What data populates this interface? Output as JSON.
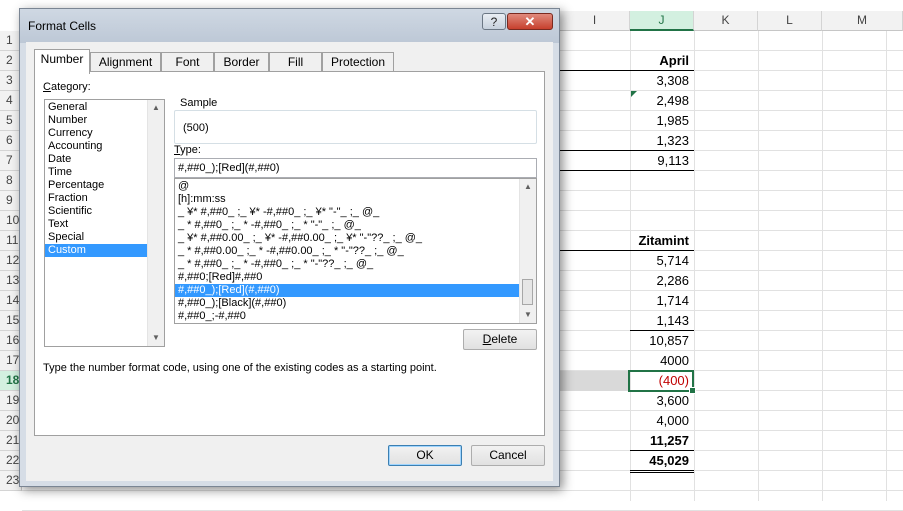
{
  "sheet": {
    "columns": [
      "I",
      "J",
      "K",
      "L",
      "M"
    ],
    "rows": [
      "1",
      "2",
      "3",
      "4",
      "5",
      "6",
      "7",
      "8",
      "9",
      "10",
      "11",
      "12",
      "13",
      "14",
      "15",
      "16",
      "17",
      "18",
      "19",
      "20",
      "21",
      "22",
      "23"
    ],
    "cells": {
      "r2": "April",
      "r3": "3,308",
      "r4": "2,498",
      "r5": "1,985",
      "r6": "1,323",
      "r7": "9,113",
      "r11": "Zitamint",
      "r12": "5,714",
      "r13": "2,286",
      "r14": "1,714",
      "r15": "1,143",
      "r16": "10,857",
      "r17": "4000",
      "r18": "(400)",
      "r19": "3,600",
      "r20": "4,000",
      "r21": "11,257",
      "r22": "45,029"
    },
    "negative_color": "#c00000",
    "accent": "#217346"
  },
  "dialog": {
    "title": "Format Cells",
    "help_glyph": "?",
    "close_glyph": "✕",
    "tabs": [
      "Number",
      "Alignment",
      "Font",
      "Border",
      "Fill",
      "Protection"
    ],
    "active_tab": "Number",
    "category_label_u": "C",
    "category_label_rest": "ategory:",
    "categories": [
      "General",
      "Number",
      "Currency",
      "Accounting",
      "Date",
      "Time",
      "Percentage",
      "Fraction",
      "Scientific",
      "Text",
      "Special",
      "Custom"
    ],
    "selected_category": "Custom",
    "sample_label": "Sample",
    "sample_value": "(500)",
    "type_label_u": "T",
    "type_label_rest": "ype:",
    "type_value": "#,##0_);[Red](#,##0)",
    "formats": [
      "@",
      "[h]:mm:ss",
      "_ ¥* #,##0_ ;_ ¥* -#,##0_ ;_ ¥* \"-\"_ ;_ @_",
      "_ * #,##0_ ;_ * -#,##0_ ;_ * \"-\"_ ;_ @_",
      "_ ¥* #,##0.00_ ;_ ¥* -#,##0.00_ ;_ ¥* \"-\"??_ ;_ @_",
      "_ * #,##0.00_ ;_ * -#,##0.00_ ;_ * \"-\"??_ ;_ @_",
      "_ * #,##0_ ;_ * -#,##0_ ;_ * \"-\"??_ ;_ @_",
      "#,##0;[Red]#,##0",
      "#,##0_);[Red](#,##0)",
      "#,##0_);[Black](#,##0)",
      "#,##0_;-#,##0"
    ],
    "selected_format_index": 8,
    "delete_u": "D",
    "delete_rest": "elete",
    "hint": "Type the number format code, using one of the existing codes as a starting point.",
    "ok_label": "OK",
    "cancel_label": "Cancel",
    "selection_color": "#3399ff"
  }
}
